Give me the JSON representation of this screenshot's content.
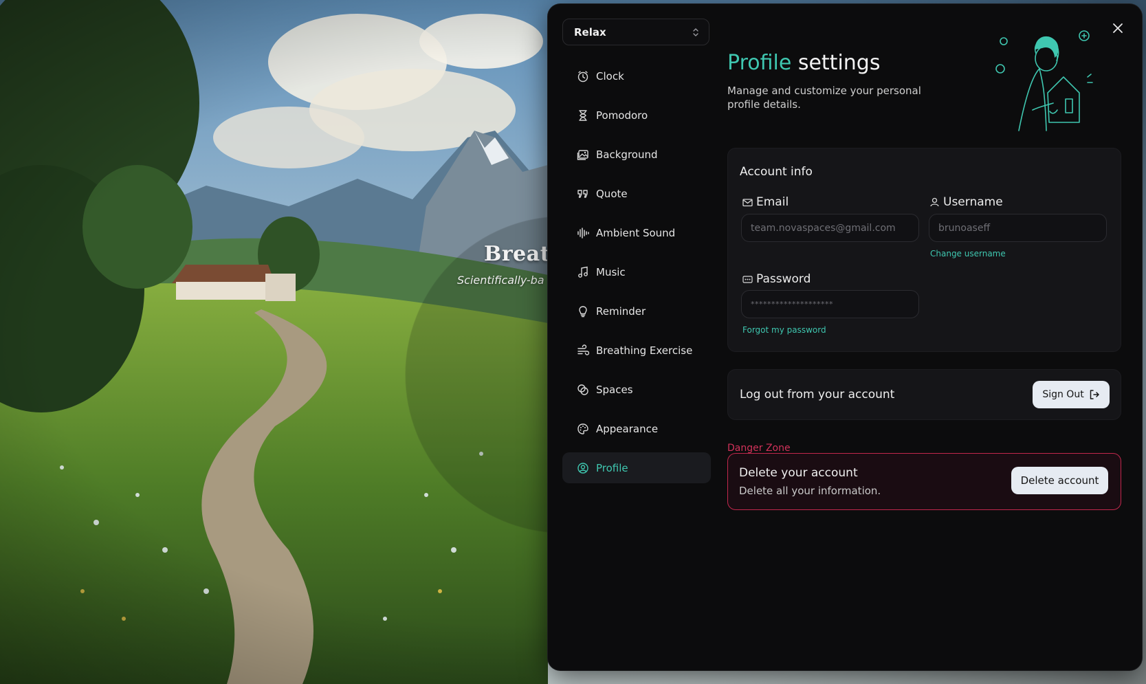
{
  "background": {
    "breathing_title": "Breath",
    "breathing_subtitle": "Scientifically-ba"
  },
  "sidebar": {
    "space_select": {
      "value": "Relax"
    },
    "items": [
      {
        "label": "Clock",
        "icon": "clock-icon"
      },
      {
        "label": "Pomodoro",
        "icon": "hourglass-icon"
      },
      {
        "label": "Background",
        "icon": "image-icon"
      },
      {
        "label": "Quote",
        "icon": "quote-icon"
      },
      {
        "label": "Ambient Sound",
        "icon": "sound-wave-icon"
      },
      {
        "label": "Music",
        "icon": "music-note-icon"
      },
      {
        "label": "Reminder",
        "icon": "lightbulb-icon"
      },
      {
        "label": "Breathing Exercise",
        "icon": "wind-icon"
      },
      {
        "label": "Spaces",
        "icon": "spaces-icon"
      },
      {
        "label": "Appearance",
        "icon": "palette-icon"
      },
      {
        "label": "Profile",
        "icon": "user-circle-icon",
        "active": true
      }
    ]
  },
  "header": {
    "title_accent": "Profile",
    "title_rest": "settings",
    "description": "Manage and customize your personal profile details."
  },
  "account_info": {
    "title": "Account info",
    "email": {
      "label": "Email",
      "placeholder": "team.novaspaces@gmail.com"
    },
    "username": {
      "label": "Username",
      "placeholder": "brunoaseff",
      "link": "Change username"
    },
    "password": {
      "label": "Password",
      "value": "********************",
      "link": "Forgot my password"
    }
  },
  "logout": {
    "text": "Log out from your account",
    "button": "Sign Out"
  },
  "danger_zone": {
    "label": "Danger Zone",
    "title": "Delete your account",
    "description": "Delete all your information.",
    "button": "Delete account"
  },
  "colors": {
    "accent": "#3fc7b0",
    "danger": "#c2284d",
    "panel": "#0c0c0d"
  }
}
